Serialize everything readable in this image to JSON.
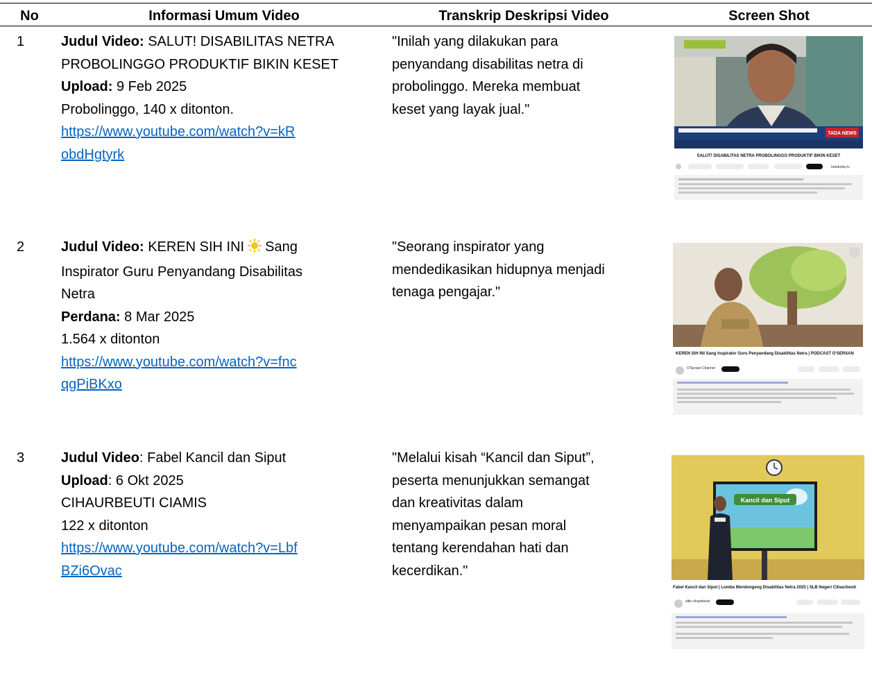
{
  "headers": {
    "no": "No",
    "info": "Informasi Umum Video",
    "transcript": "Transkrip Deskripsi Video",
    "screenshot": "Screen Shot"
  },
  "rows": [
    {
      "no": "1",
      "title_label": "Judul Video:",
      "title_line1": " SALUT! DISABILITAS NETRA",
      "title_line2": "PROBOLINGGO PRODUKTIF BIKIN KESET",
      "date_label": "Upload:",
      "date_value": " 9 Feb 2025",
      "extra1": "Probolinggo, 140 x ditonton.",
      "url_line1": "https://www.youtube.com/watch?v=kR",
      "url_line2": "obdHgtyrk",
      "transcript": [
        "\"Inilah yang dilakukan para",
        "penyandang disabilitas netra di",
        "probolinggo. Mereka membuat",
        "keset yang layak jual.\""
      ],
      "shot": {
        "video_caption": "SALUT! DISABILITAS NETRA PROBOLINGGO PRODUKTIF BIKIN KESET",
        "channel": "tadatoday.tv",
        "banner_brand": "TADA NEWS"
      }
    },
    {
      "no": "2",
      "title_label": "Judul Video:",
      "title_line1": " KEREN SIH INI",
      "title_line1b": "Sang",
      "title_line2": "Inspirator Guru Penyandang Disabilitas",
      "title_line3": "Netra",
      "date_label": "Perdana:",
      "date_value": " 8 Mar 2025",
      "extra1": "1.564 x ditonton",
      "url_line1": "https://www.youtube.com/watch?v=fnc",
      "url_line2": "qgPiBKxo",
      "transcript": [
        "\"Seorang inspirator yang",
        "mendedikasikan hidupnya menjadi",
        "tenaga pengajar.\""
      ],
      "shot": {
        "video_caption": "KEREN SIH INI Sang Inspirator Guru Penyandang Disabilitas Netra | PODCAST O'SERSAN",
        "channel": "O'Sersan Channel"
      }
    },
    {
      "no": "3",
      "title_label": "Judul Video",
      "title_line1": ": Fabel Kancil dan Siput",
      "date_label": "Upload",
      "date_value": ": 6 Okt 2025",
      "extra1": "CIHAURBEUTI CIAMIS",
      "extra2": "122 x ditonton",
      "url_line1": "https://www.youtube.com/watch?v=Lbf",
      "url_line2": "BZi6Ovac",
      "transcript": [
        "\"Melalui kisah “Kancil dan Siput”,",
        "peserta menunjukkan semangat",
        "dan kreativitas dalam",
        "menyampaikan pesan moral",
        "tentang kerendahan hati dan",
        "kecerdikan.\""
      ],
      "shot": {
        "video_caption": "Fabel Kancil dan Siput | Lomba Mendongeng Disabilitas Netra 2025 | SLB Negeri Cihaurbeuti",
        "channel": "slbn cihaurbeuti",
        "screen_text": "Kancil dan Siput"
      }
    }
  ],
  "colors": {
    "link": "#0563c1",
    "youtube_subscribe": "#0f0f0f"
  }
}
